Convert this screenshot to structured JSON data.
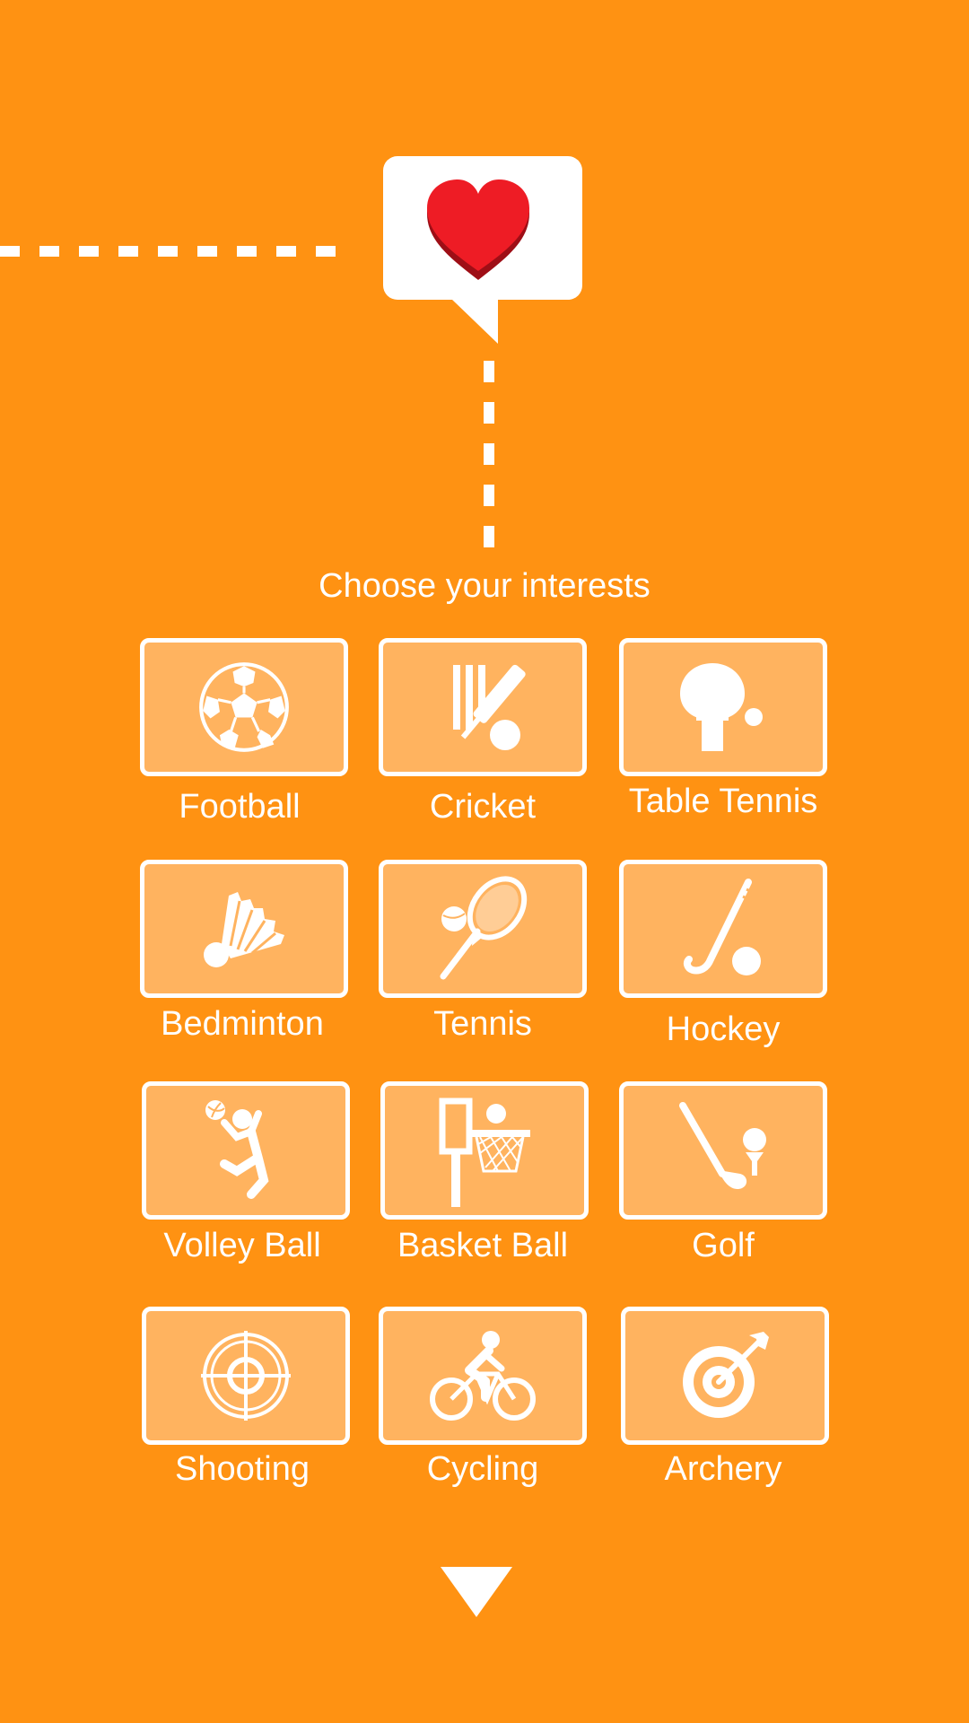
{
  "header": {
    "title": "Choose your interests"
  },
  "colors": {
    "background": "#FF9212",
    "tile_fill": "#FFB35F",
    "tile_border": "#FFFFFF",
    "heart": "#EE1C25",
    "heart_shadow": "#9E0E16"
  },
  "interests": [
    {
      "label": "Football",
      "icon": "football-icon"
    },
    {
      "label": "Cricket",
      "icon": "cricket-icon"
    },
    {
      "label": "Table Tennis",
      "icon": "table-tennis-icon"
    },
    {
      "label": "Bedminton",
      "icon": "shuttlecock-icon"
    },
    {
      "label": "Tennis",
      "icon": "tennis-racket-icon"
    },
    {
      "label": "Hockey",
      "icon": "hockey-stick-icon"
    },
    {
      "label": "Volley Ball",
      "icon": "volleyball-player-icon"
    },
    {
      "label": "Basket Ball",
      "icon": "basketball-hoop-icon"
    },
    {
      "label": "Golf",
      "icon": "golf-club-icon"
    },
    {
      "label": "Shooting",
      "icon": "crosshair-icon"
    },
    {
      "label": "Cycling",
      "icon": "cyclist-icon"
    },
    {
      "label": "Archery",
      "icon": "archery-target-icon"
    }
  ],
  "decor": {
    "bubble_icon": "heart-icon",
    "next_icon": "down-arrow-icon"
  }
}
